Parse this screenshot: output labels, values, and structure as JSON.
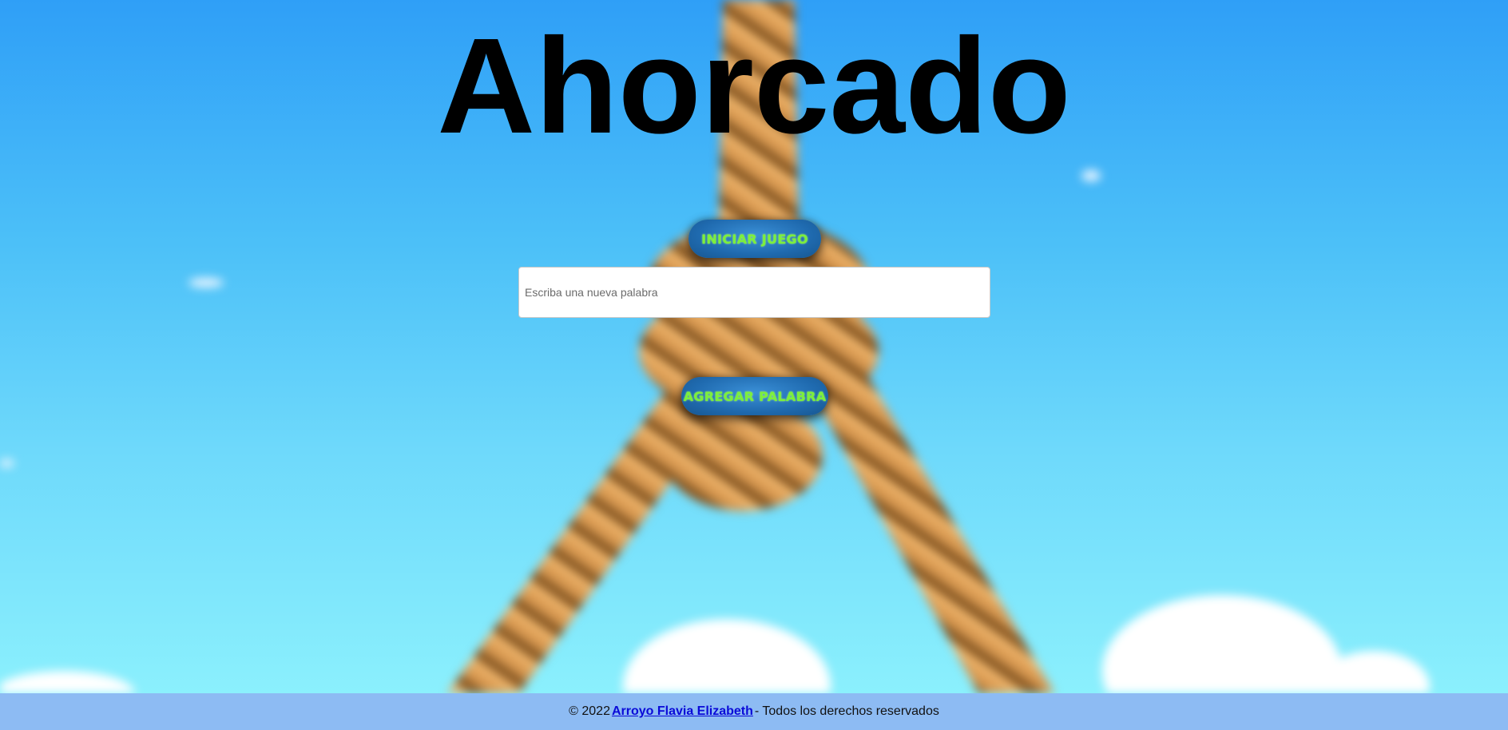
{
  "app": {
    "title": "Ahorcado"
  },
  "buttons": {
    "start_label": "INICIAR JUEGO",
    "add_label": "AGREGAR PALABRA"
  },
  "word_input": {
    "value": "",
    "placeholder": "Escriba una nueva palabra"
  },
  "footer": {
    "prefix": "© 2022",
    "author_link": "Arroyo Flavia Elizabeth",
    "suffix": "- Todos los derechos reservados"
  },
  "colors": {
    "sky_top": "#2f9ff7",
    "sky_bottom": "#8bf0fd",
    "button_bg": "#1f6aaf",
    "button_text": "#7cf03a",
    "footer_bg": "#8dbbf3",
    "link": "#0a0ad8"
  },
  "background_icon": "noose-rope-illustration"
}
